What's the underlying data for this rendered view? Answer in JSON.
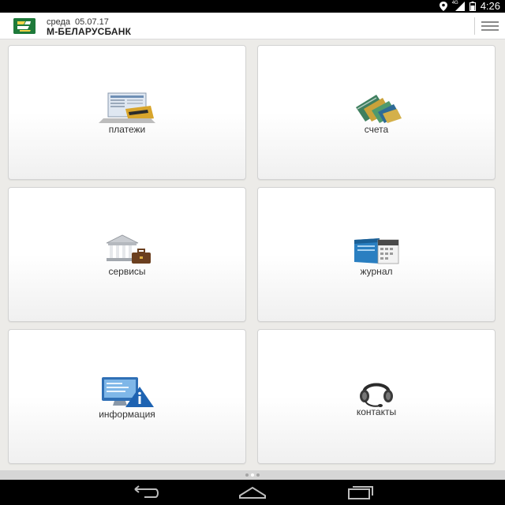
{
  "status_bar": {
    "time": "4:26",
    "network": "4G",
    "icons": [
      "location-icon",
      "signal-icon",
      "battery-icon"
    ]
  },
  "header": {
    "day": "среда",
    "date": "05.07.17",
    "title": "М-БЕЛАРУСБАНК",
    "logo": "belarusbank-logo",
    "menu_icon": "hamburger-menu-icon",
    "brand_color": "#1e7a3a"
  },
  "tiles": [
    {
      "label": "платежи",
      "icon": "payments-icon"
    },
    {
      "label": "счета",
      "icon": "cards-icon"
    },
    {
      "label": "сервисы",
      "icon": "bank-services-icon"
    },
    {
      "label": "журнал",
      "icon": "journal-icon"
    },
    {
      "label": "информация",
      "icon": "info-icon"
    },
    {
      "label": "контакты",
      "icon": "headset-icon"
    }
  ],
  "pager": {
    "pages": 3,
    "active": 2
  },
  "nav_bar": [
    "back-icon",
    "home-icon",
    "recent-apps-icon"
  ]
}
